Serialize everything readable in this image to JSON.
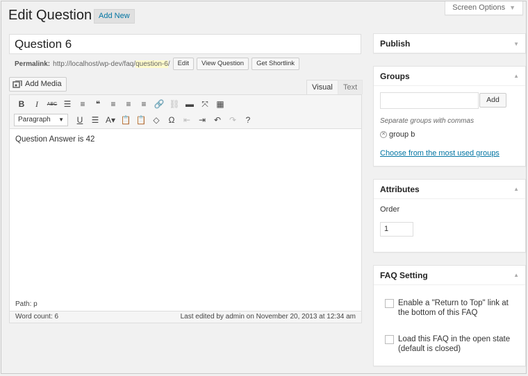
{
  "header": {
    "page_title": "Edit Question",
    "add_new_label": "Add New",
    "screen_options_label": "Screen Options"
  },
  "post": {
    "title_value": "Question 6",
    "permalink_label": "Permalink:",
    "permalink_base": "http://localhost/wp-dev/faq/",
    "permalink_slug": "question-6",
    "permalink_tail": "/",
    "edit_label": "Edit",
    "view_label": "View Question",
    "shortlink_label": "Get Shortlink"
  },
  "editor": {
    "add_media_label": "Add Media",
    "tab_visual": "Visual",
    "tab_text": "Text",
    "format_value": "Paragraph",
    "content": "Question Answer is 42",
    "path_text": "Path: p",
    "word_count": "Word count: 6",
    "last_edited": "Last edited by admin on November 20, 2013 at 12:34 am",
    "toolbar_row1": [
      {
        "name": "bold-icon",
        "glyph": "B"
      },
      {
        "name": "italic-icon",
        "glyph": "I"
      },
      {
        "name": "strikethrough-icon",
        "glyph": "ABC"
      },
      {
        "name": "bullet-list-icon",
        "glyph": "☰"
      },
      {
        "name": "numbered-list-icon",
        "glyph": "≡"
      },
      {
        "name": "blockquote-icon",
        "glyph": "❝"
      },
      {
        "name": "align-left-icon",
        "glyph": "≡"
      },
      {
        "name": "align-center-icon",
        "glyph": "≡"
      },
      {
        "name": "align-right-icon",
        "glyph": "≡"
      },
      {
        "name": "insert-link-icon",
        "glyph": "🔗"
      },
      {
        "name": "unlink-icon",
        "glyph": "⛓"
      },
      {
        "name": "read-more-icon",
        "glyph": "▬"
      },
      {
        "name": "fullscreen-icon",
        "glyph": "⤧"
      },
      {
        "name": "kitchen-sink-icon",
        "glyph": "▦"
      }
    ],
    "toolbar_row2": [
      {
        "name": "underline-icon",
        "glyph": "U"
      },
      {
        "name": "justify-icon",
        "glyph": "☰"
      },
      {
        "name": "text-color-icon",
        "glyph": "A▾"
      },
      {
        "name": "paste-text-icon",
        "glyph": "📋"
      },
      {
        "name": "paste-word-icon",
        "glyph": "📋"
      },
      {
        "name": "clear-formatting-icon",
        "glyph": "◇"
      },
      {
        "name": "special-character-icon",
        "glyph": "Ω"
      },
      {
        "name": "outdent-icon",
        "glyph": "⇤"
      },
      {
        "name": "indent-icon",
        "glyph": "⇥"
      },
      {
        "name": "undo-icon",
        "glyph": "↶"
      },
      {
        "name": "redo-icon",
        "glyph": "↷"
      },
      {
        "name": "help-icon",
        "glyph": "?"
      }
    ]
  },
  "sidebar": {
    "publish_title": "Publish",
    "groups_title": "Groups",
    "groups_add_label": "Add",
    "groups_hint": "Separate groups with commas",
    "group_tag": "group b",
    "most_used_link": "Choose from the most used groups",
    "attributes_title": "Attributes",
    "order_label": "Order",
    "order_value": "1",
    "faq_title": "FAQ Setting",
    "faq_option_1": "Enable a \"Return to Top\" link at the bottom of this FAQ",
    "faq_option_2": "Load this FAQ in the open state (default is closed)"
  },
  "colors": {
    "link": "#0074a2",
    "slug_highlight": "#fffbcc",
    "background": "#f1f1f1"
  }
}
